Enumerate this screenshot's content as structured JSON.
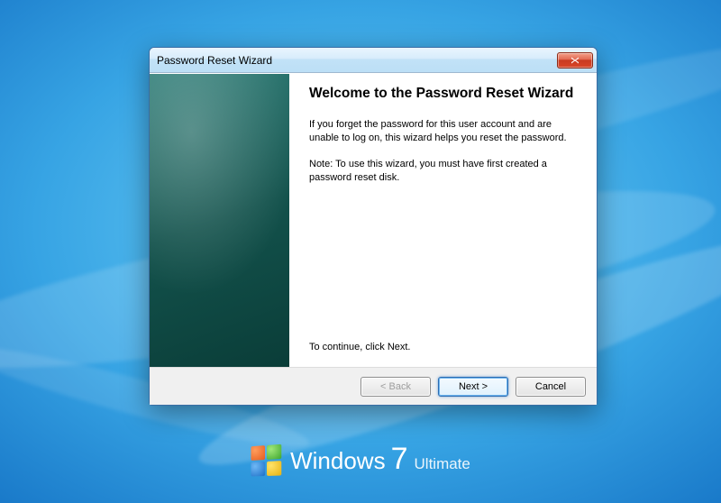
{
  "dialog": {
    "title": "Password Reset Wizard",
    "heading": "Welcome to the Password Reset Wizard",
    "para1": "If you forget the password for this user account and are unable to log on, this wizard helps you reset the password.",
    "para2": "Note: To use this wizard, you must have first created a password reset disk.",
    "continue_hint": "To continue, click Next.",
    "buttons": {
      "back": "< Back",
      "next": "Next >",
      "cancel": "Cancel"
    }
  },
  "branding": {
    "word": "Windows",
    "version": "7",
    "edition": "Ultimate"
  }
}
